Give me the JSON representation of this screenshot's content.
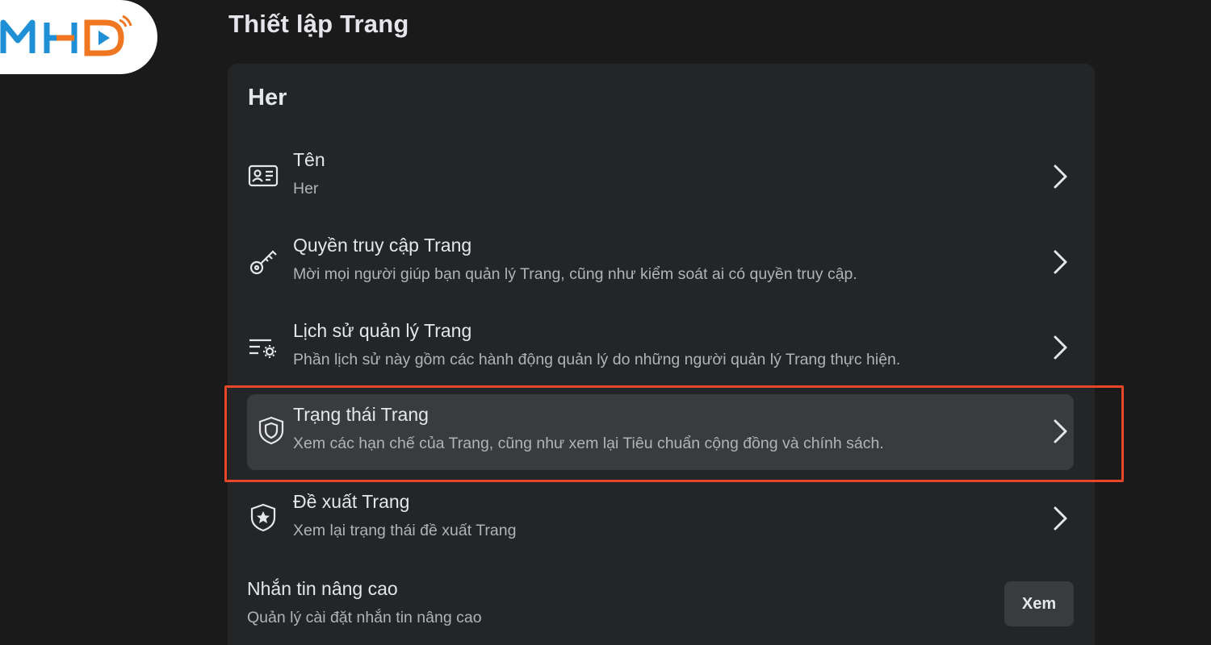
{
  "logo": {
    "text": "MHD",
    "accent": "#1f8fd6",
    "brand": "#f07722"
  },
  "page": {
    "title": "Thiết lập Trang"
  },
  "card": {
    "title": "Her",
    "items": [
      {
        "icon": "id-card-icon",
        "title": "Tên",
        "desc": "Her"
      },
      {
        "icon": "key-icon",
        "title": "Quyền truy cập Trang",
        "desc": "Mời mọi người giúp bạn quản lý Trang, cũng như kiểm soát ai có quyền truy cập."
      },
      {
        "icon": "history-settings-icon",
        "title": "Lịch sử quản lý Trang",
        "desc": "Phần lịch sử này gồm các hành động quản lý do những người quản lý Trang thực hiện."
      },
      {
        "icon": "shield-icon",
        "title": "Trạng thái Trang",
        "desc": "Xem các hạn chế của Trang, cũng như xem lại Tiêu chuẩn cộng đồng và chính sách."
      },
      {
        "icon": "shield-star-icon",
        "title": "Đề xuất Trang",
        "desc": "Xem lại trạng thái đề xuất Trang"
      }
    ],
    "advanced": {
      "title": "Nhắn tin nâng cao",
      "desc": "Quản lý cài đặt nhắn tin nâng cao",
      "button": "Xem"
    }
  },
  "colors": {
    "highlight": "#e8462a",
    "background": "#1a1a1a",
    "card": "#242526"
  }
}
